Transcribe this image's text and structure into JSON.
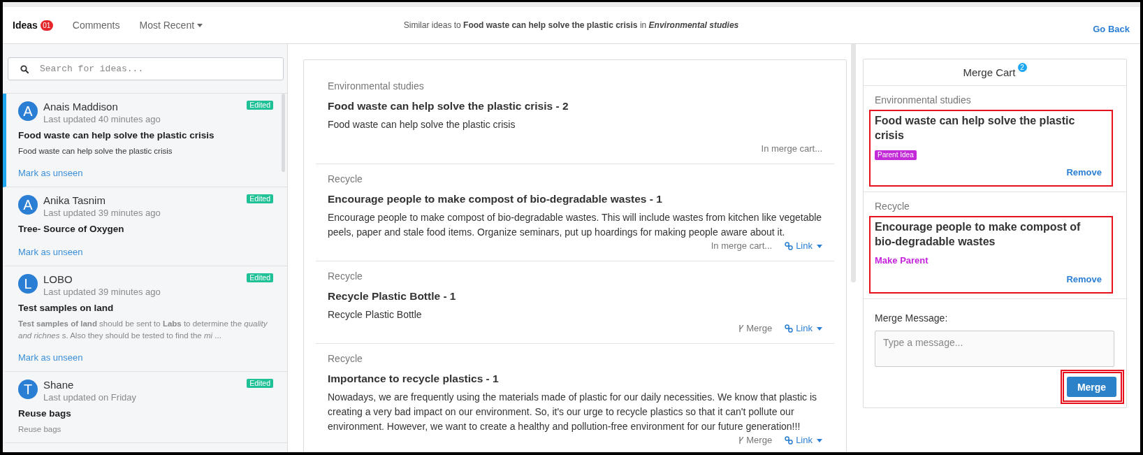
{
  "header": {
    "tabs": [
      {
        "kind": "tab",
        "label": "Ideas",
        "badge": "01",
        "selected": true
      },
      {
        "kind": "tab",
        "label": "Comments",
        "selected": false
      },
      {
        "kind": "dropdown",
        "label": "Most Recent",
        "selected": false
      }
    ],
    "heading": {
      "prefix": "Similar ideas to",
      "idea": "Food waste can help solve the plastic crisis",
      "connector": "in",
      "category": "Environmental studies"
    },
    "go_back": "Go Back"
  },
  "sidebar": {
    "search": {
      "placeholder": "Search for ideas..."
    },
    "ideas": [
      {
        "initial": "A",
        "author": "Anais Maddison",
        "updated": "Last updated 40 minutes ago",
        "badge": "Edited",
        "title": "Food waste can help solve the plastic crisis",
        "description": "Food waste can help solve the plastic crisis",
        "action": "Mark as unseen",
        "selected": true
      },
      {
        "initial": "A",
        "author": "Anika Tasnim",
        "updated": "Last updated 39 minutes ago",
        "badge": "Edited",
        "title": "Tree- Source of Oxygen",
        "action": "Mark as unseen",
        "selected": false
      },
      {
        "initial": "L",
        "author": "LOBO",
        "updated": "Last updated 39 minutes ago",
        "badge": "Edited",
        "title": "Test samples on land",
        "description": "**Test samples of land** should be sent to **Labs** to determine the *quality and richnes* s. Also they should be tested to find the *mi* ...",
        "action": "Mark as unseen",
        "selected": false
      },
      {
        "initial": "T",
        "author": "Shane",
        "updated": "Last updated on Friday",
        "badge": "Edited",
        "title": "Reuse bags",
        "description": "Reuse bags",
        "selected": false
      }
    ]
  },
  "similar_ideas": [
    {
      "category": "Environmental studies",
      "title": "Food waste can help solve the plastic crisis - 2",
      "description": "Food waste can help solve the plastic crisis",
      "actions": [
        {
          "kind": "status",
          "label": "In merge cart..."
        }
      ]
    },
    {
      "category": "Recycle",
      "title": "Encourage people to make compost of bio-degradable wastes - 1",
      "description": "Encourage people to make compost of bio-degradable wastes. This will include wastes from kitchen like vegetable peels, paper and stale food items. Organize seminars, put up hoardings for making people aware about it.",
      "actions": [
        {
          "kind": "status",
          "label": "In merge cart..."
        },
        {
          "kind": "link",
          "label": "Link"
        }
      ]
    },
    {
      "category": "Recycle",
      "title": "Recycle Plastic Bottle - 1",
      "description": "Recycle Plastic Bottle",
      "actions": [
        {
          "kind": "merge",
          "label": "Merge"
        },
        {
          "kind": "link",
          "label": "Link"
        }
      ]
    },
    {
      "category": "Recycle",
      "title": "Importance to recycle plastics - 1",
      "description": "Nowadays, we are frequently using the materials made of plastic for our daily necessities. We know that plastic is creating a very bad impact on our environment. So, it's our urge to recycle plastics so that it can't pollute our environment. However, we want to create a healthy and pollution-free environment for our future generation!!!",
      "actions": [
        {
          "kind": "merge",
          "label": "Merge"
        },
        {
          "kind": "link",
          "label": "Link"
        }
      ]
    }
  ],
  "merge_cart": {
    "title": "Merge Cart",
    "count": "2",
    "items": [
      {
        "category": "Environmental studies",
        "title": "Food waste can help solve the plastic crisis",
        "highlighted": true,
        "role": {
          "kind": "badge",
          "label": "Parent Idea"
        },
        "remove": "Remove"
      },
      {
        "category": "Recycle",
        "title": "Encourage people to make compost of bio-degradable wastes",
        "highlighted": true,
        "role": {
          "kind": "action",
          "label": "Make Parent"
        },
        "remove": "Remove"
      }
    ],
    "message": {
      "label": "Merge Message:",
      "placeholder": "Type a message..."
    },
    "button": {
      "label": "Merge",
      "highlighted": true
    }
  }
}
